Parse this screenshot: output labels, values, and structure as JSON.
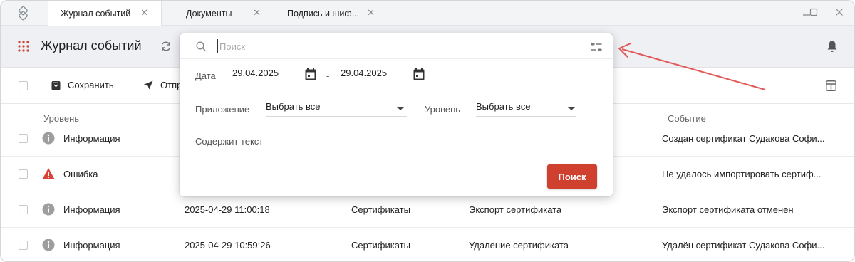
{
  "tabs": [
    {
      "label": "Журнал событий",
      "active": true
    },
    {
      "label": "Документы",
      "active": false
    },
    {
      "label": "Подпись и шиф...",
      "active": false
    }
  ],
  "tab_close_glyph": "✕",
  "window_controls": {
    "minimize": "—",
    "maximize": "☐",
    "close": "✕"
  },
  "header": {
    "title": "Журнал событий"
  },
  "toolbar": {
    "save_label": "Сохранить",
    "send_label": "Отпр"
  },
  "table": {
    "headers": {
      "level": "Уровень",
      "event": "Событие"
    },
    "rows": [
      {
        "level": "Информация",
        "level_type": "info",
        "datetime": "",
        "app": "",
        "action": "",
        "event": "Создан сертификат Судакова Софи..."
      },
      {
        "level": "Ошибка",
        "level_type": "error",
        "datetime": "",
        "app": "",
        "action": "",
        "event": "Не удалось импортировать сертиф..."
      },
      {
        "level": "Информация",
        "level_type": "info",
        "datetime": "2025-04-29 11:00:18",
        "app": "Сертификаты",
        "action": "Экспорт сертификата",
        "event": "Экспорт сертификата отменен"
      },
      {
        "level": "Информация",
        "level_type": "info",
        "datetime": "2025-04-29 10:59:26",
        "app": "Сертификаты",
        "action": "Удаление сертификата",
        "event": "Удалён сертификат Судакова Софи..."
      }
    ]
  },
  "search_popup": {
    "placeholder": "Поиск",
    "date_label": "Дата",
    "date_from": "29.04.2025",
    "date_separator": "-",
    "date_to": "29.04.2025",
    "app_label": "Приложение",
    "app_value": "Выбрать все",
    "level_label": "Уровень",
    "level_value": "Выбрать все",
    "contains_label": "Содержит текст",
    "contains_value": "",
    "search_button": "Поиск"
  },
  "colors": {
    "accent": "#d0402f",
    "error": "#d9443a",
    "info": "#9e9e9e",
    "annotation": "#e05a5a"
  },
  "icons": [
    "app-logo-icon",
    "apps-grid-icon",
    "refresh-icon",
    "bell-icon",
    "save-icon",
    "send-icon",
    "layout-icon",
    "search-icon",
    "filter-icon",
    "calendar-icon",
    "info-icon",
    "error-icon",
    "chevron-down-icon"
  ]
}
